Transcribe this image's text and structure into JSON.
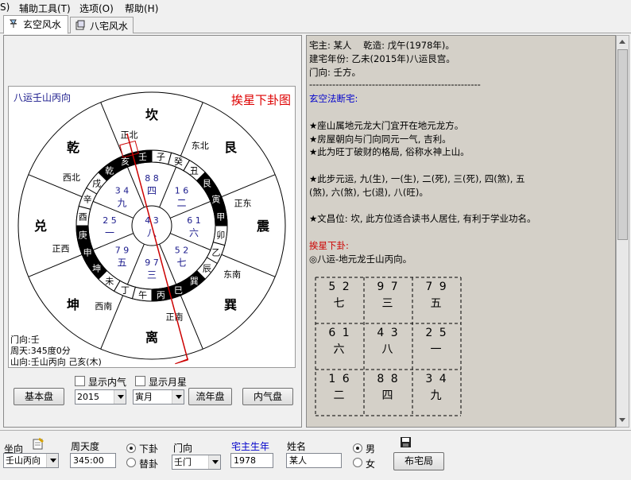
{
  "menu": [
    "S)",
    "辅助工具(T)",
    "选项(O)",
    "帮助(H)"
  ],
  "tabs": [
    {
      "label": "玄空风水"
    },
    {
      "label": "八宅风水"
    }
  ],
  "chart": {
    "top_left": "八运壬山丙向",
    "title": "挨星下卦图",
    "info_lines": [
      "门向:壬",
      "周天:345度0分",
      "山向:壬山丙向 己亥(木)"
    ],
    "trigrams": [
      "离",
      "坤",
      "兑",
      "乾",
      "坎",
      "艮",
      "震",
      "巽"
    ],
    "directions": [
      "正南",
      "西南",
      "正西",
      "西北",
      "正北",
      "东北",
      "正东",
      "东南"
    ],
    "mountains": [
      "丙",
      "午",
      "丁",
      "未",
      "坤",
      "申",
      "庚",
      "酉",
      "辛",
      "戌",
      "乾",
      "亥",
      "壬",
      "子",
      "癸",
      "丑",
      "艮",
      "寅",
      "甲",
      "卯",
      "乙",
      "辰",
      "巽",
      "巳"
    ],
    "palaces": [
      {
        "nums": "9 7",
        "gua": "三"
      },
      {
        "nums": "7 9",
        "gua": "五"
      },
      {
        "nums": "2 5",
        "gua": "一"
      },
      {
        "nums": "3 4",
        "gua": "九"
      },
      {
        "nums": "8 8",
        "gua": "四"
      },
      {
        "nums": "1 6",
        "gua": "二"
      },
      {
        "nums": "6 1",
        "gua": "六"
      },
      {
        "nums": "5 2",
        "gua": "七"
      },
      {
        "nums": "4 3",
        "gua": "八"
      }
    ]
  },
  "controls": {
    "show_inner": "显示内气",
    "show_month": "显示月星",
    "basic_btn": "基本盘",
    "year_value": "2015",
    "month_value": "寅月",
    "flow_btn": "流年盘",
    "inner_btn": "内气盘"
  },
  "analysis": {
    "lines": [
      {
        "t": "宅主: 某人    乾造: 戊午(1978年)。",
        "c": "#000"
      },
      {
        "t": "建宅年份: 乙未(2015年)八运艮宫。",
        "c": "#000"
      },
      {
        "t": "门向: 壬方。",
        "c": "#000"
      },
      {
        "t": "----------------------------------------------------",
        "c": "#000"
      },
      {
        "t": "玄空法断宅:",
        "c": "#0000cc"
      },
      {
        "t": "",
        "c": "#000"
      },
      {
        "t": "★座山属地元龙大门宜开在地元龙方。",
        "c": "#000"
      },
      {
        "t": "★房屋朝向与门向同元一气, 吉利。",
        "c": "#000"
      },
      {
        "t": "★此为旺丁破财的格局, 俗称水神上山。",
        "c": "#000"
      },
      {
        "t": "",
        "c": "#000"
      },
      {
        "t": "★此步元运, 九(生), 一(生), 二(死), 三(死), 四(煞), 五",
        "c": "#000"
      },
      {
        "t": "(煞), 六(煞), 七(退), 八(旺)。",
        "c": "#000"
      },
      {
        "t": "",
        "c": "#000"
      },
      {
        "t": "★文昌位: 坎, 此方位适合读书人居住, 有利于学业功名。",
        "c": "#000"
      },
      {
        "t": "",
        "c": "#000"
      },
      {
        "t": "挨星下卦:",
        "c": "#cc0000"
      },
      {
        "t": "◎八运-地元龙壬山丙向。",
        "c": "#000"
      }
    ],
    "grid": [
      {
        "nums": "5 2",
        "gua": "七"
      },
      {
        "nums": "9 7",
        "gua": "三"
      },
      {
        "nums": "7 9",
        "gua": "五"
      },
      {
        "nums": "6 1",
        "gua": "六"
      },
      {
        "nums": "4 3",
        "gua": "八"
      },
      {
        "nums": "2 5",
        "gua": "一"
      },
      {
        "nums": "1 6",
        "gua": "二"
      },
      {
        "nums": "8 8",
        "gua": "四"
      },
      {
        "nums": "3 4",
        "gua": "九"
      }
    ]
  },
  "bottom": {
    "zuoxiang_label": "坐向",
    "zuoxiang_value": "壬山丙向",
    "zhoutian_label": "周天度",
    "zhoutian_value": "345:00",
    "xiagua": "下卦",
    "tigua": "替卦",
    "menxiang_label": "门向",
    "menxiang_value": "壬门",
    "owner_year_label": "宅主生年",
    "owner_year_value": "1978",
    "name_label": "姓名",
    "name_value": "某人",
    "male": "男",
    "female": "女",
    "layout_btn": "布宅局"
  }
}
